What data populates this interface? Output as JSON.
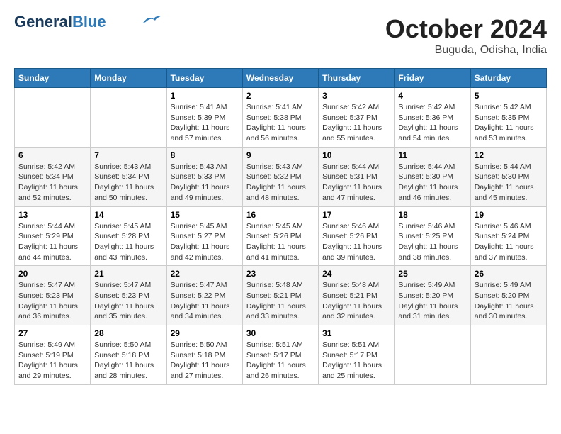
{
  "header": {
    "logo_general": "General",
    "logo_blue": "Blue",
    "month": "October 2024",
    "location": "Buguda, Odisha, India"
  },
  "weekdays": [
    "Sunday",
    "Monday",
    "Tuesday",
    "Wednesday",
    "Thursday",
    "Friday",
    "Saturday"
  ],
  "weeks": [
    [
      {
        "day": "",
        "content": ""
      },
      {
        "day": "",
        "content": ""
      },
      {
        "day": "1",
        "content": "Sunrise: 5:41 AM\nSunset: 5:39 PM\nDaylight: 11 hours and 57 minutes."
      },
      {
        "day": "2",
        "content": "Sunrise: 5:41 AM\nSunset: 5:38 PM\nDaylight: 11 hours and 56 minutes."
      },
      {
        "day": "3",
        "content": "Sunrise: 5:42 AM\nSunset: 5:37 PM\nDaylight: 11 hours and 55 minutes."
      },
      {
        "day": "4",
        "content": "Sunrise: 5:42 AM\nSunset: 5:36 PM\nDaylight: 11 hours and 54 minutes."
      },
      {
        "day": "5",
        "content": "Sunrise: 5:42 AM\nSunset: 5:35 PM\nDaylight: 11 hours and 53 minutes."
      }
    ],
    [
      {
        "day": "6",
        "content": "Sunrise: 5:42 AM\nSunset: 5:34 PM\nDaylight: 11 hours and 52 minutes."
      },
      {
        "day": "7",
        "content": "Sunrise: 5:43 AM\nSunset: 5:34 PM\nDaylight: 11 hours and 50 minutes."
      },
      {
        "day": "8",
        "content": "Sunrise: 5:43 AM\nSunset: 5:33 PM\nDaylight: 11 hours and 49 minutes."
      },
      {
        "day": "9",
        "content": "Sunrise: 5:43 AM\nSunset: 5:32 PM\nDaylight: 11 hours and 48 minutes."
      },
      {
        "day": "10",
        "content": "Sunrise: 5:44 AM\nSunset: 5:31 PM\nDaylight: 11 hours and 47 minutes."
      },
      {
        "day": "11",
        "content": "Sunrise: 5:44 AM\nSunset: 5:30 PM\nDaylight: 11 hours and 46 minutes."
      },
      {
        "day": "12",
        "content": "Sunrise: 5:44 AM\nSunset: 5:30 PM\nDaylight: 11 hours and 45 minutes."
      }
    ],
    [
      {
        "day": "13",
        "content": "Sunrise: 5:44 AM\nSunset: 5:29 PM\nDaylight: 11 hours and 44 minutes."
      },
      {
        "day": "14",
        "content": "Sunrise: 5:45 AM\nSunset: 5:28 PM\nDaylight: 11 hours and 43 minutes."
      },
      {
        "day": "15",
        "content": "Sunrise: 5:45 AM\nSunset: 5:27 PM\nDaylight: 11 hours and 42 minutes."
      },
      {
        "day": "16",
        "content": "Sunrise: 5:45 AM\nSunset: 5:26 PM\nDaylight: 11 hours and 41 minutes."
      },
      {
        "day": "17",
        "content": "Sunrise: 5:46 AM\nSunset: 5:26 PM\nDaylight: 11 hours and 39 minutes."
      },
      {
        "day": "18",
        "content": "Sunrise: 5:46 AM\nSunset: 5:25 PM\nDaylight: 11 hours and 38 minutes."
      },
      {
        "day": "19",
        "content": "Sunrise: 5:46 AM\nSunset: 5:24 PM\nDaylight: 11 hours and 37 minutes."
      }
    ],
    [
      {
        "day": "20",
        "content": "Sunrise: 5:47 AM\nSunset: 5:23 PM\nDaylight: 11 hours and 36 minutes."
      },
      {
        "day": "21",
        "content": "Sunrise: 5:47 AM\nSunset: 5:23 PM\nDaylight: 11 hours and 35 minutes."
      },
      {
        "day": "22",
        "content": "Sunrise: 5:47 AM\nSunset: 5:22 PM\nDaylight: 11 hours and 34 minutes."
      },
      {
        "day": "23",
        "content": "Sunrise: 5:48 AM\nSunset: 5:21 PM\nDaylight: 11 hours and 33 minutes."
      },
      {
        "day": "24",
        "content": "Sunrise: 5:48 AM\nSunset: 5:21 PM\nDaylight: 11 hours and 32 minutes."
      },
      {
        "day": "25",
        "content": "Sunrise: 5:49 AM\nSunset: 5:20 PM\nDaylight: 11 hours and 31 minutes."
      },
      {
        "day": "26",
        "content": "Sunrise: 5:49 AM\nSunset: 5:20 PM\nDaylight: 11 hours and 30 minutes."
      }
    ],
    [
      {
        "day": "27",
        "content": "Sunrise: 5:49 AM\nSunset: 5:19 PM\nDaylight: 11 hours and 29 minutes."
      },
      {
        "day": "28",
        "content": "Sunrise: 5:50 AM\nSunset: 5:18 PM\nDaylight: 11 hours and 28 minutes."
      },
      {
        "day": "29",
        "content": "Sunrise: 5:50 AM\nSunset: 5:18 PM\nDaylight: 11 hours and 27 minutes."
      },
      {
        "day": "30",
        "content": "Sunrise: 5:51 AM\nSunset: 5:17 PM\nDaylight: 11 hours and 26 minutes."
      },
      {
        "day": "31",
        "content": "Sunrise: 5:51 AM\nSunset: 5:17 PM\nDaylight: 11 hours and 25 minutes."
      },
      {
        "day": "",
        "content": ""
      },
      {
        "day": "",
        "content": ""
      }
    ]
  ]
}
